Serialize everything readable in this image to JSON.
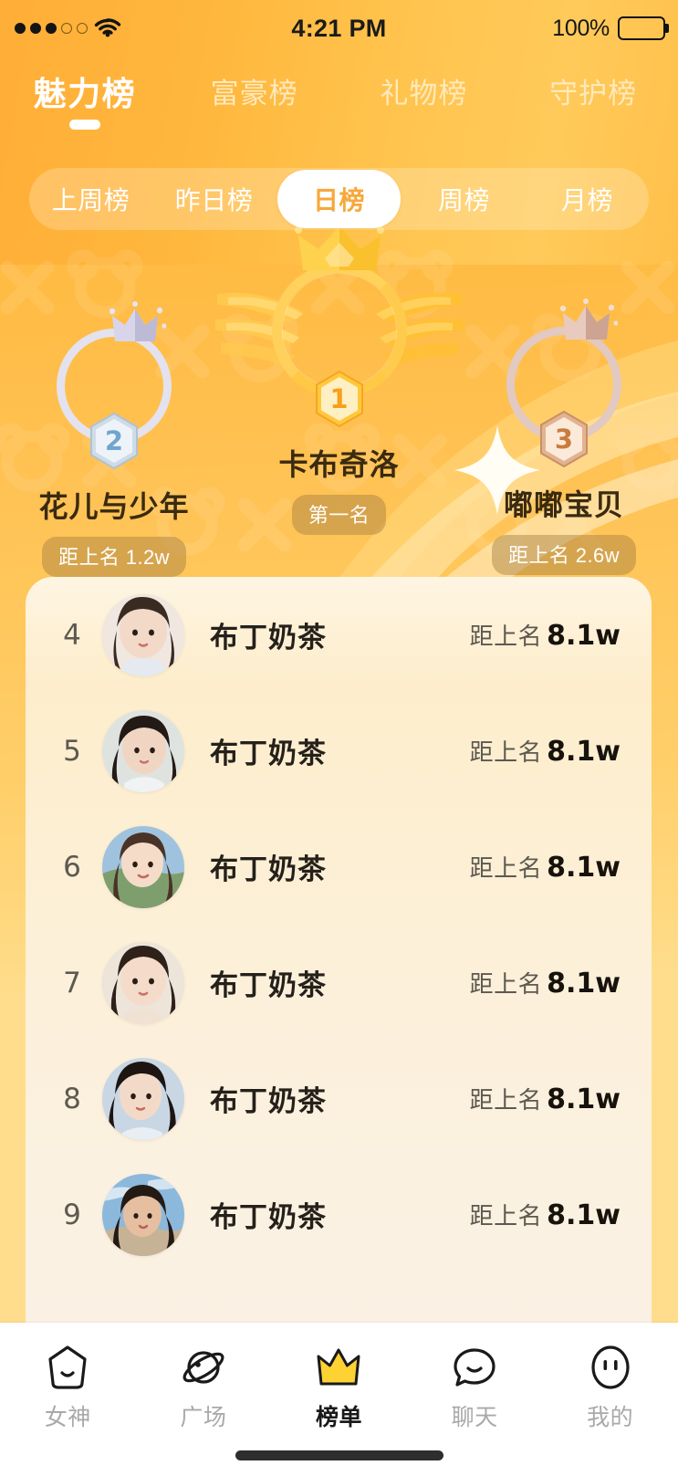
{
  "status_bar": {
    "signal_dots_filled": 3,
    "signal_dots_total": 5,
    "wifi_icon": "wifi-icon",
    "time": "4:21 PM",
    "battery_percent": "100%",
    "battery_icon": "battery-full-icon"
  },
  "top_tabs": {
    "active_index": 0,
    "items": [
      {
        "label": "魅力榜"
      },
      {
        "label": "富豪榜"
      },
      {
        "label": "礼物榜"
      },
      {
        "label": "守护榜"
      }
    ]
  },
  "segment_filter": {
    "active_index": 2,
    "items": [
      {
        "label": "上周榜"
      },
      {
        "label": "昨日榜"
      },
      {
        "label": "日榜"
      },
      {
        "label": "周榜"
      },
      {
        "label": "月榜"
      }
    ]
  },
  "podium": {
    "first": {
      "rank": "1",
      "name": "卡布奇洛",
      "pill": "第一名",
      "badge_color": "#F6A01B",
      "ring_color": "#FFCB4D",
      "crown_icon": "gold-crown-icon",
      "wings_icon": "golden-wings-icon"
    },
    "second": {
      "rank": "2",
      "name": "花儿与少年",
      "pill": "距上名 1.2w",
      "badge_color": "#6FA5CF",
      "ring_color": "#E3E2EE",
      "crown_icon": "silver-crown-icon"
    },
    "third": {
      "rank": "3",
      "name": "嘟嘟宝贝",
      "pill": "距上名 2.6w",
      "badge_color": "#C97C3E",
      "ring_color": "#E2C9C1",
      "crown_icon": "bronze-crown-icon"
    }
  },
  "ranking_list": {
    "gap_label": "距上名",
    "rows": [
      {
        "rank": "4",
        "name": "布丁奶茶",
        "gap_label": "距上名",
        "gap_value": "8.1w"
      },
      {
        "rank": "5",
        "name": "布丁奶茶",
        "gap_label": "距上名",
        "gap_value": "8.1w"
      },
      {
        "rank": "6",
        "name": "布丁奶茶",
        "gap_label": "距上名",
        "gap_value": "8.1w"
      },
      {
        "rank": "7",
        "name": "布丁奶茶",
        "gap_label": "距上名",
        "gap_value": "8.1w"
      },
      {
        "rank": "8",
        "name": "布丁奶茶",
        "gap_label": "距上名",
        "gap_value": "8.1w"
      },
      {
        "rank": "9",
        "name": "布丁奶茶",
        "gap_label": "距上名",
        "gap_value": "8.1w"
      }
    ]
  },
  "tabbar": {
    "active_index": 2,
    "items": [
      {
        "label": "女神",
        "icon": "goddess-icon"
      },
      {
        "label": "广场",
        "icon": "planet-icon"
      },
      {
        "label": "榜单",
        "icon": "crown-icon"
      },
      {
        "label": "聊天",
        "icon": "chat-bubble-icon"
      },
      {
        "label": "我的",
        "icon": "profile-face-icon"
      }
    ]
  },
  "colors": {
    "brand_orange": "#FFB13C",
    "accent_yellow": "#FFD25C",
    "active_pill_text": "#F7A83B",
    "card_cream": "#FDEBC6",
    "crown_active": "#FFD233"
  }
}
